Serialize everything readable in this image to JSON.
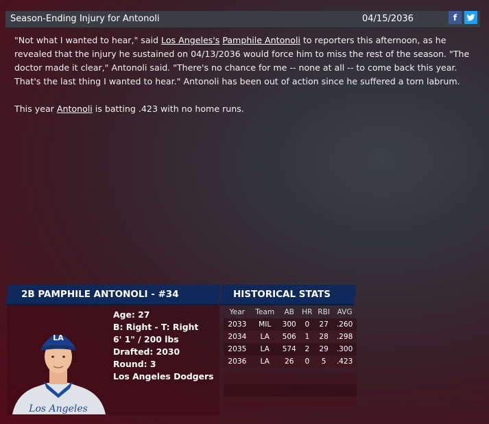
{
  "header": {
    "title": "Season-Ending Injury for Antonoli",
    "date": "04/15/2036",
    "facebook_label": "f"
  },
  "article": {
    "p1_part1": "\"Not what I wanted to hear,\" said ",
    "team_link": "Los Angeles's",
    "p1_space": " ",
    "player_link": "Pamphile Antonoli",
    "p1_part2": " to reporters this afternoon, as he revealed that the injury he sustained on 04/13/2036 would force him to miss the rest of the season. \"The doctor made it clear,\" Antonoli said. \"There's no chance for me -- none at all -- to come back this year. That's the last thing I wanted to hear.\" Antonoli has been out of action since he suffered a torn labrum.",
    "p2_part1": "This year ",
    "p2_link": "Antonoli",
    "p2_part2": " is batting .423 with no home runs."
  },
  "player": {
    "banner": "2B PAMPHILE ANTONOLI - #34",
    "age": "Age: 27",
    "bats_throws": "B: Right - T: Right",
    "height_weight": "6' 1\" / 200 lbs",
    "drafted": "Drafted: 2030",
    "round": "Round: 3",
    "team": "Los Angeles Dodgers",
    "cap_logo": "LA",
    "jersey_text": "Los Angeles"
  },
  "stats": {
    "banner": "HISTORICAL STATS",
    "headers": [
      "Year",
      "Team",
      "AB",
      "HR",
      "RBI",
      "AVG"
    ],
    "rows": [
      [
        "2033",
        "MIL",
        "300",
        "0",
        "27",
        ".260"
      ],
      [
        "2034",
        "LA",
        "506",
        "1",
        "28",
        ".298"
      ],
      [
        "2035",
        "LA",
        "574",
        "2",
        "29",
        ".300"
      ],
      [
        "2036",
        "LA",
        "26",
        "0",
        "5",
        ".423"
      ]
    ]
  },
  "colors": {
    "facebook": "#3b5998",
    "twitter": "#1da1f2",
    "banner_blue": "#0f2a5a"
  },
  "icons": {
    "facebook": "facebook-icon",
    "twitter": "twitter-icon"
  }
}
